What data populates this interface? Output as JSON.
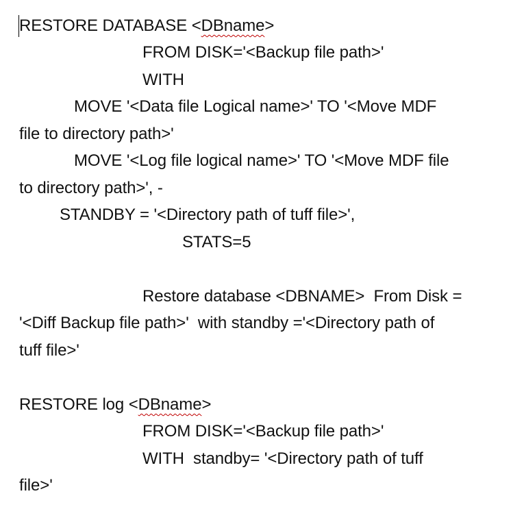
{
  "document": {
    "lines": [
      {
        "text": "RESTORE DATABASE <",
        "sq": "DBname",
        "after": ">"
      },
      {
        "text": "FROM DISK='<Backup file path>'"
      },
      {
        "text": "WITH"
      },
      {
        "text": "MOVE '<Data file Logical name>' TO '<Move MDF"
      },
      {
        "text": "file to directory path>'"
      },
      {
        "text": "MOVE '<Log file logical name>' TO '<Move MDF file"
      },
      {
        "text": "to directory path>', -"
      },
      {
        "text": "STANDBY = '<Directory path of tuff file>',"
      },
      {
        "text": "STATS=5"
      },
      {
        "text": "Restore database <DBNAME>  From Disk ="
      },
      {
        "text": "'<Diff Backup file path>'  with standby ='<Directory path of"
      },
      {
        "text": "tuff file>'"
      },
      {
        "text": "RESTORE log <",
        "sq": "DBname",
        "after": ">"
      },
      {
        "text": "FROM DISK='<Backup file path>'"
      },
      {
        "text": "WITH  standby= '<Directory path of tuff"
      },
      {
        "text": "file>'"
      }
    ]
  },
  "colors": {
    "text": "#111111",
    "spellcheck_underline": "#c00000",
    "background": "#ffffff"
  }
}
